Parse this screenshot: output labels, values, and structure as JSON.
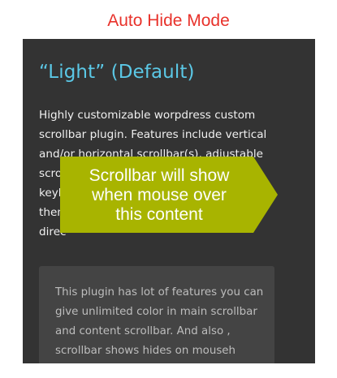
{
  "mode_title": "Auto Hide Mode",
  "panel": {
    "heading": "“Light” (Default)",
    "body_lines": [
      "Highly customizable worpdress custom",
      "scrollbar plugin. Features include vertical",
      "and/or horizontal scrollbar(s), adjustable",
      "scro",
      "keyb",
      "them",
      "direc"
    ],
    "inner_lines": [
      "This plugin has lot of features you can",
      "give unlimited color in main scrollbar",
      "and content scrollbar. And also ,",
      "scrollbar shows hides on mouseh"
    ]
  },
  "callout": {
    "lines": [
      "Scrollbar will show",
      "when mouse over",
      "this content"
    ],
    "color": "#a8b400"
  },
  "colors": {
    "title": "#e8322b",
    "panel_bg": "#333333",
    "heading": "#5bc8e6",
    "inner_bg": "#444444"
  }
}
